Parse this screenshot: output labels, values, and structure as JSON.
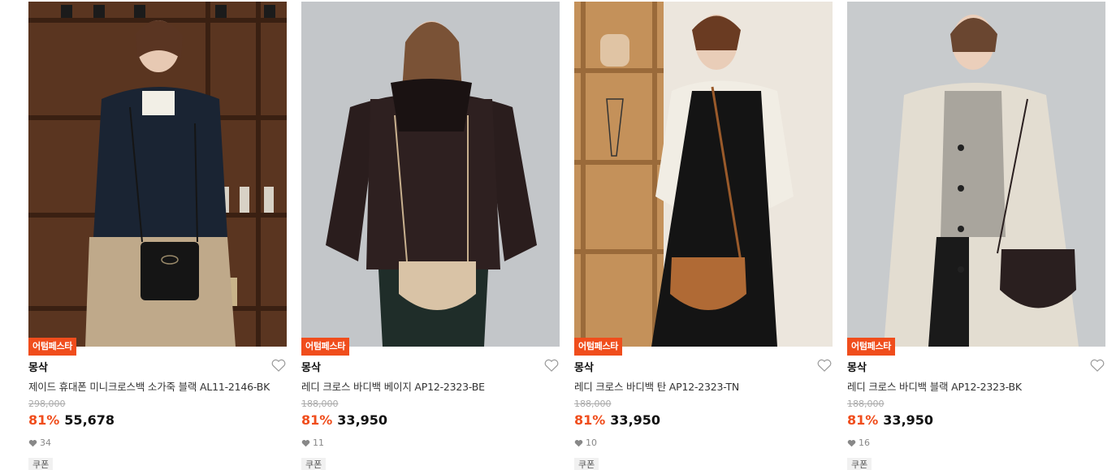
{
  "products": [
    {
      "badge": "어텀페스타",
      "brand": "몽삭",
      "name": "제이드 휴대폰 미니크로스백 소가죽 블랙 AL11-2146-BK",
      "original_price": "298,000",
      "discount": "81%",
      "price": "55,678",
      "likes": "34",
      "coupon": "쿠폰",
      "bag_color": "#151515",
      "image_icon": "product-photo"
    },
    {
      "badge": "어텀페스타",
      "brand": "몽삭",
      "name": "레디 크로스 바디백 베이지 AP12-2323-BE",
      "original_price": "188,000",
      "discount": "81%",
      "price": "33,950",
      "likes": "11",
      "coupon": "쿠폰",
      "bag_color": "#d9c3a6",
      "image_icon": "product-photo"
    },
    {
      "badge": "어텀페스타",
      "brand": "몽삭",
      "name": "레디 크로스 바디백 탄 AP12-2323-TN",
      "original_price": "188,000",
      "discount": "81%",
      "price": "33,950",
      "likes": "10",
      "coupon": "쿠폰",
      "bag_color": "#b06a35",
      "image_icon": "product-photo"
    },
    {
      "badge": "어텀페스타",
      "brand": "몽삭",
      "name": "레디 크로스 바디백 블랙 AP12-2323-BK",
      "original_price": "188,000",
      "discount": "81%",
      "price": "33,950",
      "likes": "16",
      "coupon": "쿠폰",
      "bag_color": "#2a1f1f",
      "image_icon": "product-photo"
    }
  ],
  "colors": {
    "accent": "#f04d1c",
    "strike": "#aaaaaa",
    "muted": "#888888"
  },
  "icons": {
    "like": "heart-outline-icon",
    "likes_count": "heart-filled-icon"
  }
}
